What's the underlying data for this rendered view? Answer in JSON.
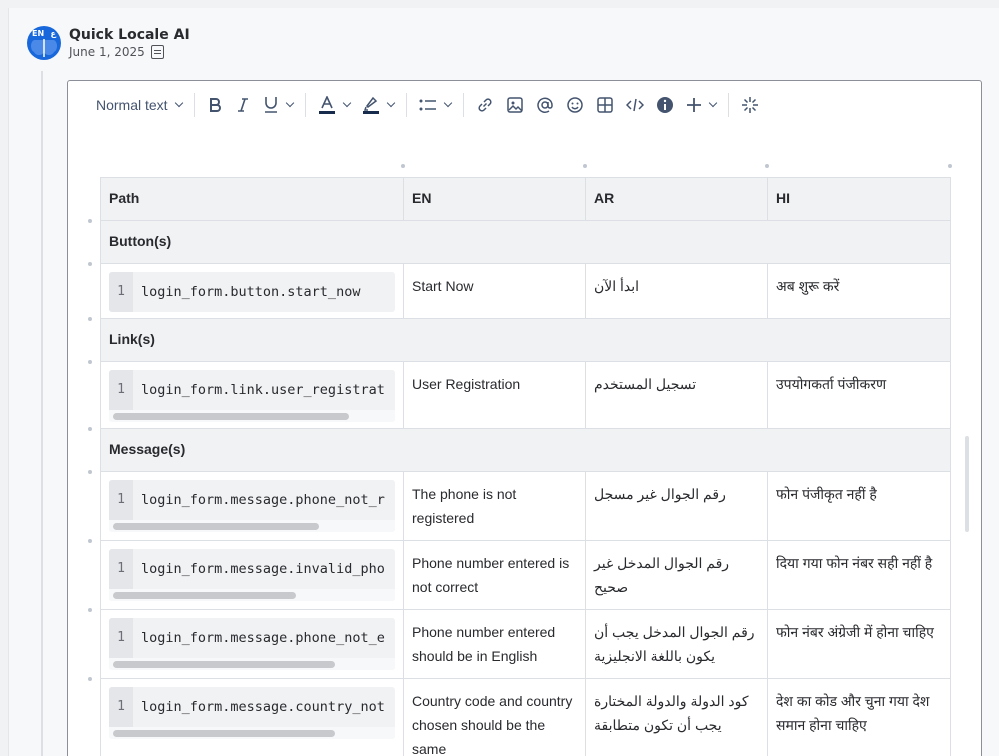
{
  "app": {
    "name": "Quick Locale AI",
    "date": "June 1, 2025",
    "avatar_left": "EN",
    "avatar_right": "ع",
    "brand_color": "#1868db"
  },
  "toolbar": {
    "text_style": "Normal text",
    "buttons": [
      {
        "name": "bold-icon",
        "glyph": "B"
      },
      {
        "name": "italic-icon",
        "glyph": "I"
      },
      {
        "name": "underline-icon",
        "glyph": "U"
      },
      {
        "name": "text-color-icon",
        "glyph": "A"
      },
      {
        "name": "highlight-icon",
        "glyph": "✎"
      },
      {
        "name": "list-icon",
        "glyph": "☰"
      },
      {
        "name": "link-icon",
        "glyph": "🔗"
      },
      {
        "name": "image-icon",
        "glyph": "▣"
      },
      {
        "name": "mention-icon",
        "glyph": "@"
      },
      {
        "name": "emoji-icon",
        "glyph": "☺"
      },
      {
        "name": "table-icon",
        "glyph": "⊞"
      },
      {
        "name": "code-icon",
        "glyph": "</>"
      },
      {
        "name": "info-icon",
        "glyph": "i"
      },
      {
        "name": "insert-icon",
        "glyph": "+"
      },
      {
        "name": "ai-icon",
        "glyph": "✳"
      }
    ]
  },
  "table": {
    "headers": [
      "Path",
      "EN",
      "AR",
      "HI"
    ],
    "groups": [
      {
        "title": "Button(s)",
        "rows": [
          {
            "line": "1",
            "path": "login_form.button.start_now",
            "scroll": 0,
            "en": "Start Now",
            "ar": "ابدأ الآن",
            "hi": "अब शुरू करें"
          }
        ]
      },
      {
        "title": "Link(s)",
        "rows": [
          {
            "line": "1",
            "path": "login_form.link.user_registrat",
            "scroll": 0.85,
            "en": "User Registration",
            "ar": "تسجيل المستخدم",
            "hi": "उपयोगकर्ता पंजीकरण"
          }
        ]
      },
      {
        "title": "Message(s)",
        "rows": [
          {
            "line": "1",
            "path": "login_form.message.phone_not_r",
            "scroll": 0.74,
            "en": "The phone is not registered",
            "ar": "رقم الجوال غير مسجل",
            "hi": "फोन पंजीकृत नहीं है"
          },
          {
            "line": "1",
            "path": "login_form.message.invalid_pho",
            "scroll": 0.66,
            "en": "Phone number entered is not correct",
            "ar": "رقم الجوال المدخل غير صحيح",
            "hi": "दिया गया फोन नंबर सही नहीं है"
          },
          {
            "line": "1",
            "path": "login_form.message.phone_not_e",
            "scroll": 0.8,
            "en": "Phone number entered should be in English",
            "ar": "رقم الجوال المدخل يجب أن يكون باللغة الانجليزية",
            "hi": "फोन नंबर अंग्रेजी में होना चाहिए"
          },
          {
            "line": "1",
            "path": "login_form.message.country_not",
            "scroll": 0.8,
            "en": "Country code and country chosen should be the same",
            "ar": "كود الدولة والدولة المختارة يجب أن تكون متطابقة",
            "hi": "देश का कोड और चुना गया देश समान होना चाहिए"
          }
        ]
      }
    ]
  }
}
